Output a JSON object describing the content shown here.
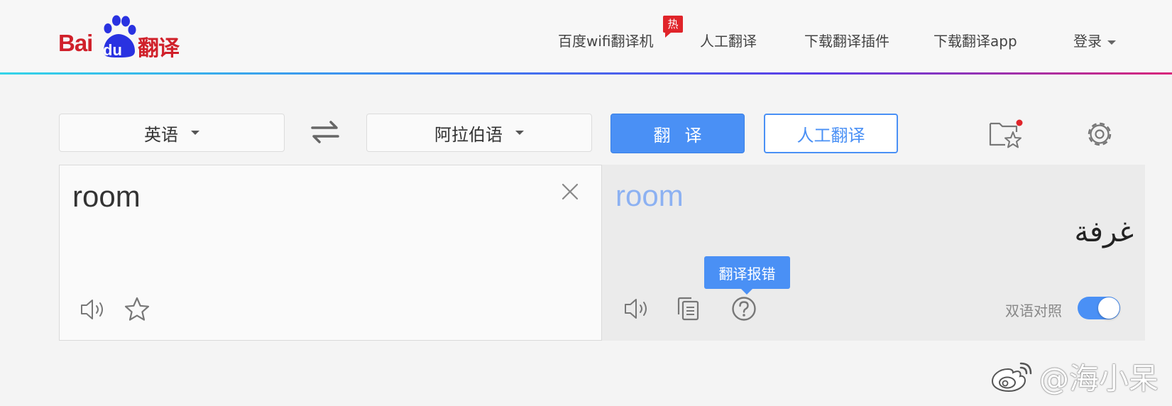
{
  "header": {
    "logo": {
      "bai": "Bai",
      "du": "du",
      "fanyi": "翻译"
    },
    "nav": [
      {
        "label": "百度wifi翻译机"
      },
      {
        "label": "人工翻译"
      },
      {
        "label": "下载翻译插件"
      },
      {
        "label": "下载翻译app"
      }
    ],
    "hot_badge": "热",
    "login_label": "登录"
  },
  "toolbar": {
    "source_language": "英语",
    "target_language": "阿拉伯语",
    "translate_label": "翻译",
    "human_translate_label": "人工翻译"
  },
  "input": {
    "text": "room"
  },
  "output": {
    "source_echo": "room",
    "result": "غرفة",
    "tooltip": "翻译报错",
    "bilingual_label": "双语对照",
    "bilingual_on": true
  },
  "watermark": {
    "text": "@海小呆"
  },
  "colors": {
    "brand_red": "#d0202a",
    "brand_blue": "#2932e1",
    "accent_blue": "#4a90f5",
    "badge_red": "#e0242a"
  },
  "icons": [
    "swap-icon",
    "folder-star-icon",
    "gear-icon",
    "clear-icon",
    "speaker-icon",
    "star-icon",
    "copy-icon",
    "help-icon",
    "weibo-icon"
  ]
}
